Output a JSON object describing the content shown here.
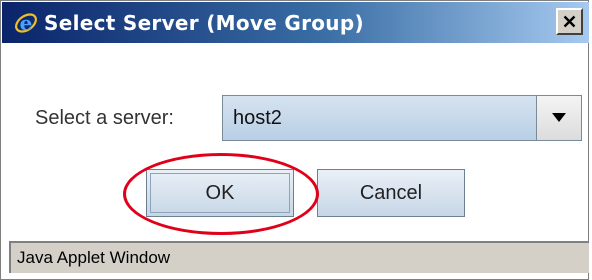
{
  "window": {
    "title": "Select Server (Move Group)",
    "close_symbol": "×"
  },
  "form": {
    "server_label": "Select a server:",
    "server_selected": "host2"
  },
  "buttons": {
    "ok_label": "OK",
    "cancel_label": "Cancel"
  },
  "statusbar": {
    "text": "Java Applet Window"
  },
  "icons": {
    "title": "ie-browser-icon",
    "close": "close-icon",
    "dropdown": "chevron-down-icon"
  },
  "colors": {
    "titlebar_start": "#0a246a",
    "titlebar_end": "#a6caf0",
    "highlight": "#e0001a",
    "select_bg": "#b8cfe5",
    "statusbar_bg": "#d4d0c8"
  }
}
